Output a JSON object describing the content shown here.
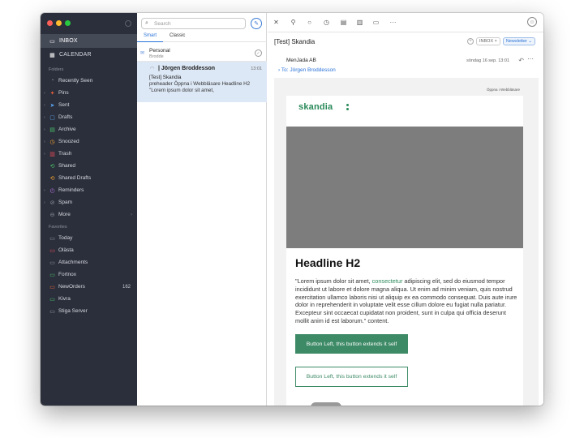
{
  "sidebar": {
    "main": [
      {
        "label": "INBOX",
        "icon": "inbox-icon",
        "active": true
      },
      {
        "label": "CALENDAR",
        "icon": "calendar-icon",
        "active": false
      }
    ],
    "folders_label": "Folders",
    "folders": [
      {
        "label": "Recently Seen",
        "icon": "history-icon",
        "color": "#8b909c",
        "chevron": false
      },
      {
        "label": "Pins",
        "icon": "pin-icon",
        "color": "#e8603c",
        "chevron": true
      },
      {
        "label": "Sent",
        "icon": "sent-icon",
        "color": "#5aa0ea",
        "chevron": true
      },
      {
        "label": "Drafts",
        "icon": "drafts-icon",
        "color": "#5aa0ea",
        "chevron": true
      },
      {
        "label": "Archive",
        "icon": "archive-icon",
        "color": "#4bbf6b",
        "chevron": true
      },
      {
        "label": "Snoozed",
        "icon": "clock-icon",
        "color": "#f0a030",
        "chevron": true
      },
      {
        "label": "Trash",
        "icon": "trash-icon",
        "color": "#e74c5b",
        "chevron": true
      },
      {
        "label": "Shared",
        "icon": "shared-icon",
        "color": "#4bbf6b",
        "chevron": false
      },
      {
        "label": "Shared Drafts",
        "icon": "shared-drafts-icon",
        "color": "#f0a030",
        "chevron": false
      },
      {
        "label": "Reminders",
        "icon": "reminder-icon",
        "color": "#b06ed8",
        "chevron": true
      },
      {
        "label": "Spam",
        "icon": "spam-icon",
        "color": "#8b909c",
        "chevron": true
      },
      {
        "label": "More",
        "icon": "more-icon",
        "color": "#8b909c",
        "chevron": false
      }
    ],
    "favorites_label": "Favorites",
    "favorites": [
      {
        "label": "Today",
        "color": "#8b909c",
        "count": ""
      },
      {
        "label": "Olästa",
        "color": "#e74c5b",
        "count": ""
      },
      {
        "label": "Attachments",
        "color": "#8b909c",
        "count": ""
      },
      {
        "label": "Fortnox",
        "color": "#4bbf6b",
        "count": ""
      },
      {
        "label": "NewOrders",
        "color": "#e8603c",
        "count": "162"
      },
      {
        "label": "Kivra",
        "color": "#4bbf6b",
        "count": ""
      },
      {
        "label": "Stiga Server",
        "color": "#8b909c",
        "count": ""
      }
    ]
  },
  "msglist": {
    "search_placeholder": "Search",
    "tabs": [
      {
        "label": "Smart",
        "active": true
      },
      {
        "label": "Classic",
        "active": false
      }
    ],
    "group_title": "Personal",
    "group_sub": "Brodde",
    "message": {
      "from": "| Jörgen Broddesson",
      "time": "13:01",
      "subject": "[Test] Skandia",
      "preview": "preheader Öppna i Webbläsare Headline H2 \"Lorem ipsum dolor sit amet,"
    }
  },
  "reader": {
    "subject": "[Test] Skandia",
    "label_chip": "INBOX ×",
    "newsletter_chip": "Newsletter ⌄",
    "sender": "MenJada AB",
    "to": "To: Jörgen Broddesson",
    "date": "söndag 16 sep. 13:01",
    "email": {
      "webview_link": "Öppna i Webbläsare",
      "logo": "skandia",
      "headline": "Headline H2",
      "body_before_link": "\"Lorem ipsum dolor sit amet, ",
      "body_link": "consectetur",
      "body_after_link": " adipiscing elit, sed do eiusmod tempor incididunt ut labore et dolore magna aliqua. Ut enim ad minim veniam, quis nostrud exercitation ullamco laboris nisi ut aliquip ex ea commodo consequat. Duis aute irure dolor in reprehenderit in voluptate velit esse cillum dolore eu fugiat nulla pariatur. Excepteur sint occaecat cupidatat non proident, sunt in culpa qui officia deserunt mollit anim id est laborum.\" content.",
      "button_solid": "Button Left, this button extends it self",
      "button_outline": "Button Left, this button extends it self",
      "accent_color": "#3d8a66"
    }
  }
}
